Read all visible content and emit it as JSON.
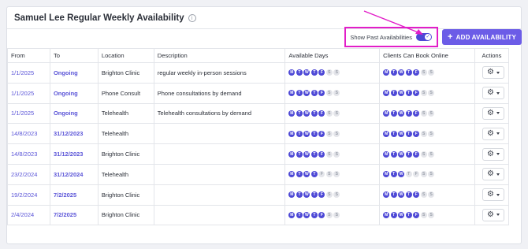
{
  "header": {
    "title": "Samuel Lee Regular Weekly Availability"
  },
  "toolbar": {
    "toggle_label": "Show Past Availabilities",
    "toggle_on": true,
    "add_label": "ADD AVAILABILITY"
  },
  "colors": {
    "accent": "#4e49d6",
    "button": "#6c5ce7",
    "highlight": "#e21ec8"
  },
  "table": {
    "columns": [
      "From",
      "To",
      "Location",
      "Description",
      "Available Days",
      "Clients Can Book Online",
      "Actions"
    ],
    "rows": [
      {
        "from": "1/1/2025",
        "to": "Ongoing",
        "location": "Brighton Clinic",
        "description": "regular weekly in-person sessions",
        "available": [
          1,
          1,
          1,
          1,
          1,
          0,
          0
        ],
        "online": [
          1,
          1,
          1,
          1,
          1,
          0,
          0
        ]
      },
      {
        "from": "1/1/2025",
        "to": "Ongoing",
        "location": "Phone Consult",
        "description": "Phone consultations by demand",
        "available": [
          1,
          1,
          1,
          1,
          1,
          0,
          0
        ],
        "online": [
          1,
          1,
          1,
          1,
          1,
          0,
          0
        ]
      },
      {
        "from": "1/1/2025",
        "to": "Ongoing",
        "location": "Telehealth",
        "description": "Telehealth consultations by demand",
        "available": [
          1,
          1,
          1,
          1,
          1,
          0,
          0
        ],
        "online": [
          1,
          1,
          1,
          1,
          1,
          0,
          0
        ]
      },
      {
        "from": "14/8/2023",
        "to": "31/12/2023",
        "location": "Telehealth",
        "description": "",
        "available": [
          1,
          1,
          1,
          1,
          1,
          0,
          0
        ],
        "online": [
          1,
          1,
          1,
          1,
          1,
          0,
          0
        ]
      },
      {
        "from": "14/8/2023",
        "to": "31/12/2023",
        "location": "Brighton Clinic",
        "description": "",
        "available": [
          1,
          1,
          1,
          1,
          1,
          0,
          0
        ],
        "online": [
          1,
          1,
          1,
          1,
          1,
          0,
          0
        ]
      },
      {
        "from": "23/2/2024",
        "to": "31/12/2024",
        "location": "Telehealth",
        "description": "",
        "available": [
          1,
          1,
          1,
          1,
          0,
          0,
          0
        ],
        "online": [
          1,
          1,
          1,
          0,
          0,
          0,
          0
        ]
      },
      {
        "from": "19/2/2024",
        "to": "7/2/2025",
        "location": "Brighton Clinic",
        "description": "",
        "available": [
          1,
          1,
          1,
          1,
          1,
          0,
          0
        ],
        "online": [
          1,
          1,
          1,
          1,
          1,
          0,
          0
        ]
      },
      {
        "from": "2/4/2024",
        "to": "7/2/2025",
        "location": "Brighton Clinic",
        "description": "",
        "available": [
          1,
          1,
          1,
          1,
          1,
          0,
          0
        ],
        "online": [
          1,
          1,
          1,
          1,
          1,
          0,
          0
        ]
      }
    ],
    "day_letters": [
      "M",
      "T",
      "W",
      "T",
      "F",
      "S",
      "S"
    ],
    "action_icon": "gear-icon"
  }
}
